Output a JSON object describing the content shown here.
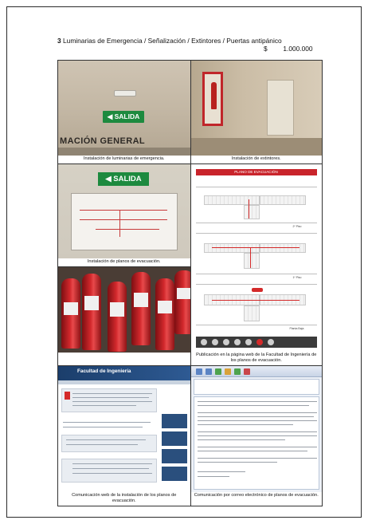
{
  "heading": {
    "number": "3",
    "text": "Luminarias de Emergencia / Señalización / Extintores / Puertas antipánico",
    "currency": "$",
    "amount": "1.000.000"
  },
  "photos": {
    "p1": {
      "sign_text": "SALIDA",
      "wall_text": "MACIÓN GENERAL",
      "caption": "Instalación de luminarias de emergencia."
    },
    "p2": {
      "caption": "Instalación de extintores."
    },
    "p3": {
      "sign_text": "SALIDA",
      "caption": "Instalación de planos de evacuación."
    },
    "p4": {
      "plan_title": "PLANO DE EVACUACIÓN",
      "floor_labels": [
        "2º Piso",
        "1º Piso",
        "Planta Baja"
      ],
      "caption": "Publicación en la página web de la Facultad de Ingeniería de los planos de evacuación."
    },
    "p6": {
      "site_title": "Facultad de Ingeniería",
      "caption": "Comunicación web de la instalación de los planos de evacuación."
    },
    "p7": {
      "caption": "Comunicación por correo electrónico de planos de evacuación."
    }
  },
  "colors": {
    "exit_green": "#1d8a3f",
    "extinguisher_red": "#d2282c",
    "plan_red": "#c9242b",
    "web_blue": "#1b3e6b"
  }
}
